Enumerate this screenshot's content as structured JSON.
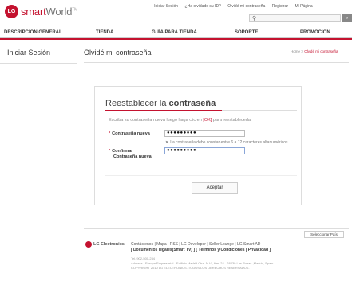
{
  "header": {
    "logo_mark": "LG",
    "logo_smart": "smart",
    "logo_world": "World",
    "logo_tm": "TM",
    "top_links": [
      "Iniciar Sesión",
      "¿Ha olvidado su ID?",
      "Olvidé mi contraseña",
      "Registrar",
      "Mi Página"
    ],
    "search_placeholder": "",
    "search_button": "Ir"
  },
  "nav": {
    "items": [
      "DESCRIPCIÓN GENERAL",
      "TIENDA",
      "GUÍA PARA TIENDA",
      "SOPORTE",
      "PROMOCIÓN"
    ]
  },
  "sidebar": {
    "title": "Iniciar Sesión"
  },
  "main": {
    "title": "Olvidé mi contraseña",
    "breadcrumb_home": "Home",
    "breadcrumb_sep": ">",
    "breadcrumb_current": "Olvidé mi contraseña"
  },
  "card": {
    "title_plain": "Reestablecer la ",
    "title_bold": "contraseña",
    "desc_before": "Escriba su contraseña nueva luego haga clic en ",
    "desc_ok": "[OK]",
    "desc_after": " para reestablecerla.",
    "new_password_label": "Contraseña nueva",
    "new_password_value": "●●●●●●●●●",
    "hint": "La contraseña debe constar entre 6 a 12 caracteres alfanuméricos.",
    "confirm_label_1": "Confirmar",
    "confirm_label_2": "Contraseña nueva",
    "confirm_value": "●●●●●●●●●",
    "accept_button": "Aceptar"
  },
  "footer": {
    "country_button": "Seleccionar País",
    "brand": "LG Electronics",
    "links": "Contáctenos | Mapa | RSS | LG Developer | Seller Lounge | LG Smart AD",
    "legal_1": "[ Documentos legales(Smart TV) ]",
    "legal_2": "[ Términos y Condiciones | Privacidad ]",
    "phone": "Tel. 902-500-234",
    "address": "Address : Europa Empresarial - Edificio Madrid Ctra. N VI, Km. 24 - 28230 Las Rozas ,Madrid, Spain",
    "copyright": "COPYRIGHT 2010 LG ELECTRONICS. TODOS LOS DERECHOS RESERVADOS."
  },
  "colors": {
    "accent": "#c4122f"
  }
}
